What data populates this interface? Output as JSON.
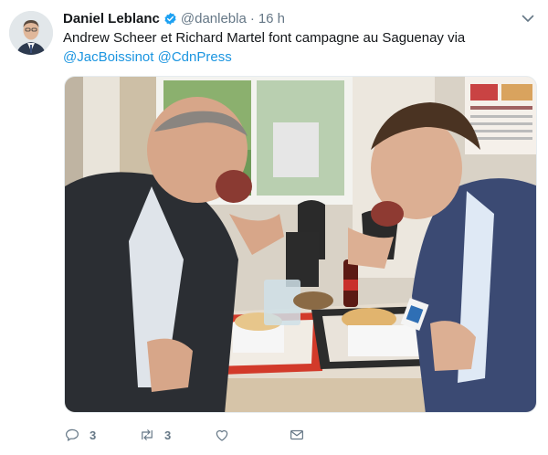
{
  "tweet": {
    "author_name": "Daniel Leblanc",
    "author_handle": "@danlebla",
    "separator": "·",
    "timestamp": "16 h",
    "text_intro": "Andrew Scheer et Richard Martel font campagne au Saguenay via",
    "mention_1": "@JacBoissinot",
    "mention_2": "@CdnPress"
  },
  "actions": {
    "reply_count": "3",
    "retweet_count": "3"
  },
  "colors": {
    "link": "#1b95e0",
    "muted": "#657786",
    "text": "#14171a",
    "verified": "#1da1f2"
  },
  "icons": {
    "verified": "verified-badge-icon",
    "chevron": "chevron-down-icon",
    "reply": "reply-icon",
    "retweet": "retweet-icon",
    "like": "heart-icon",
    "message": "envelope-icon"
  }
}
